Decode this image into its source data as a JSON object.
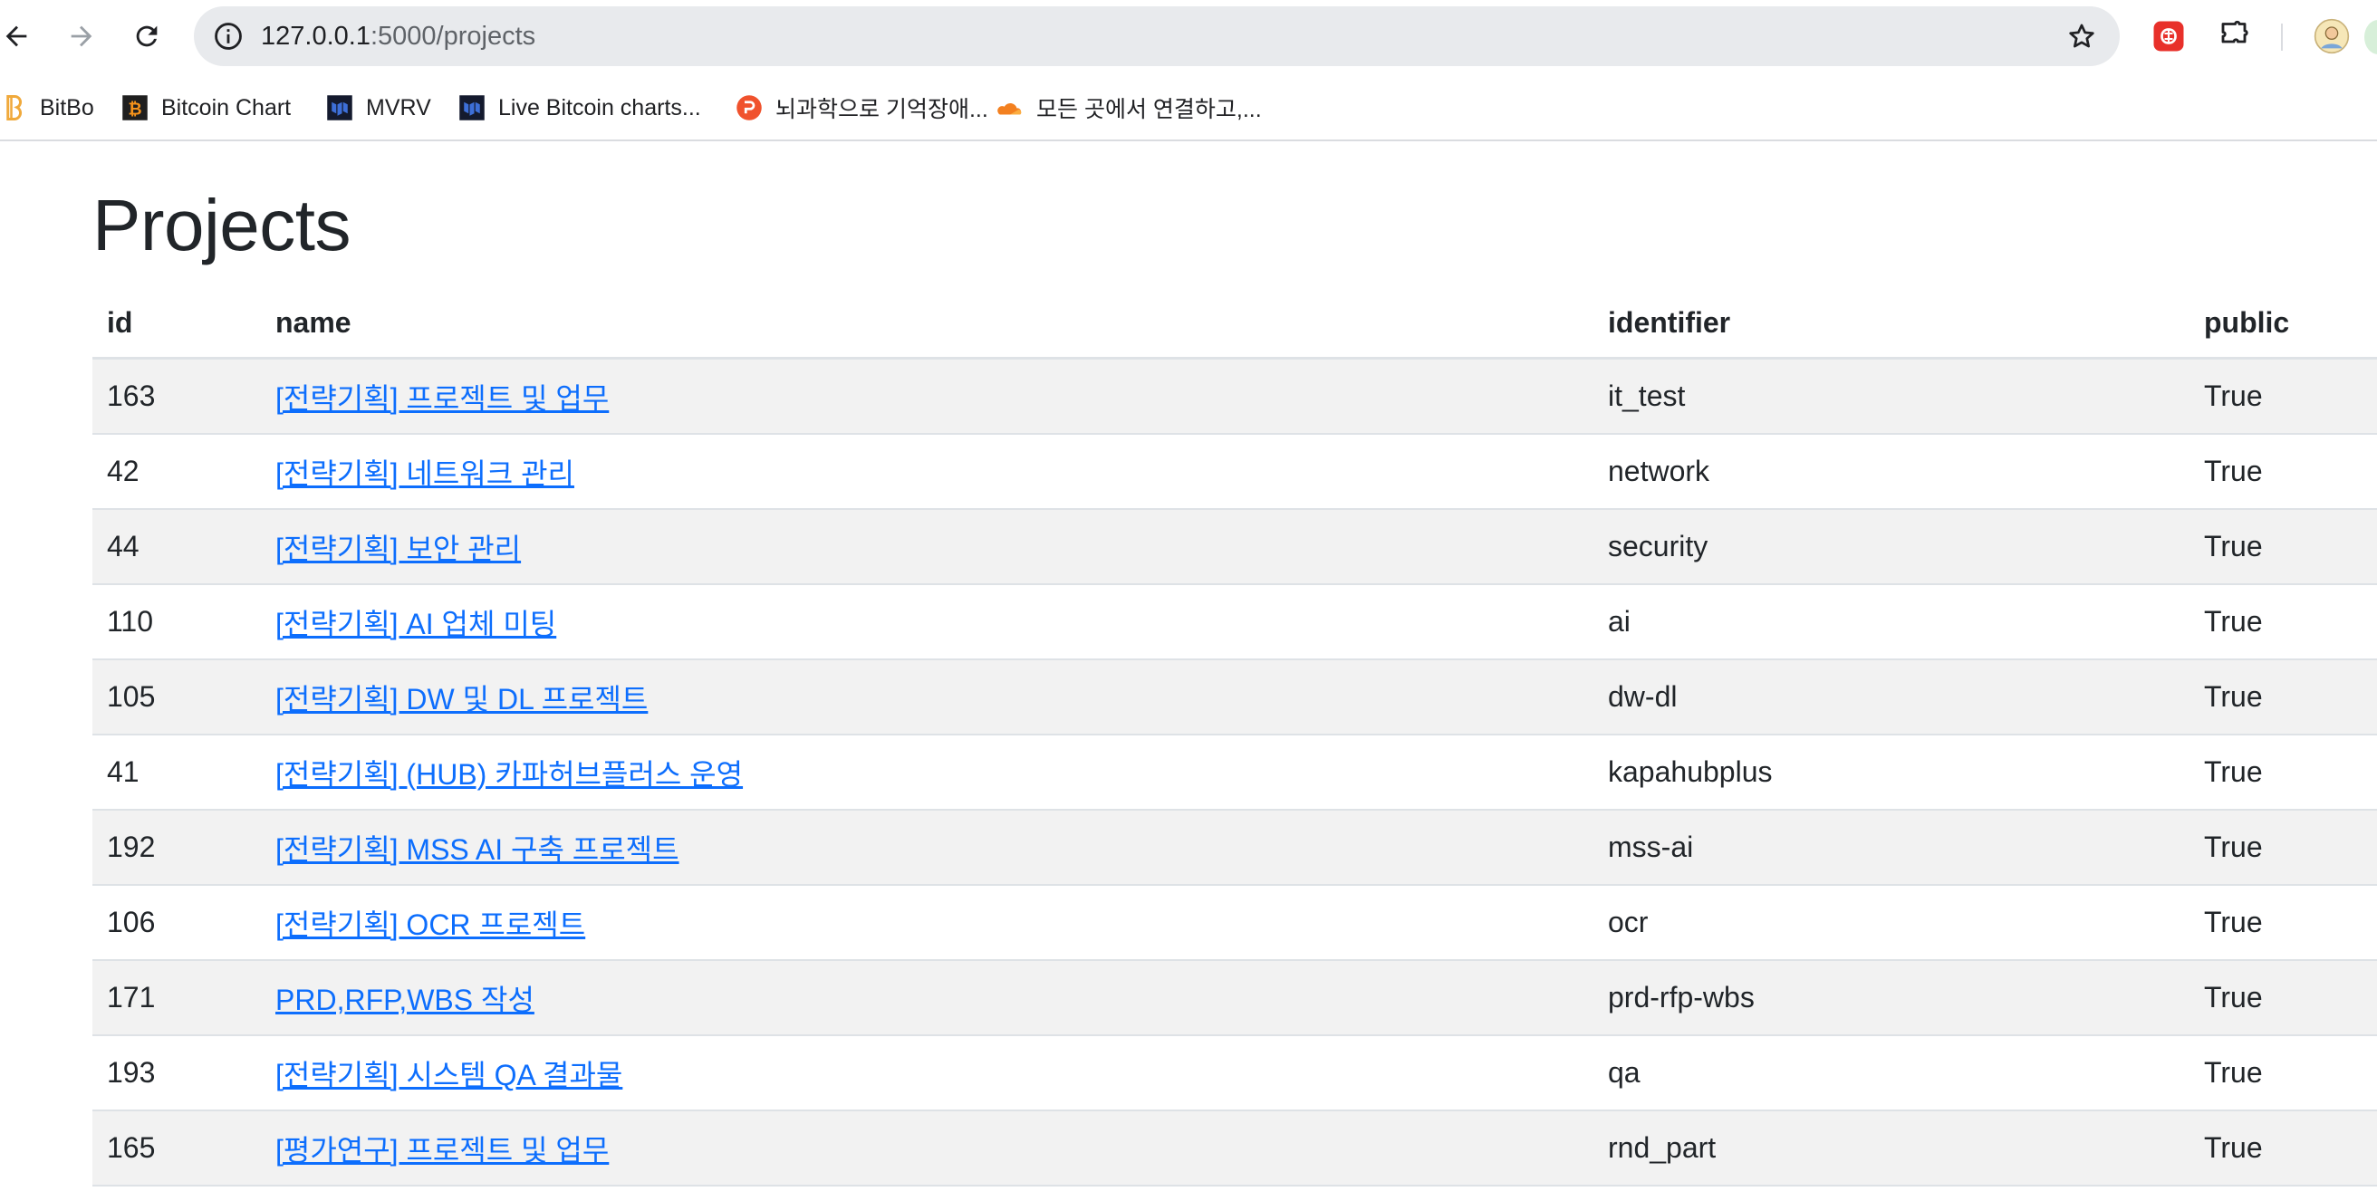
{
  "browser": {
    "url_host": "127.0.0.1",
    "url_rest": ":5000/projects",
    "bookmarks": [
      {
        "label": "BitBo",
        "icon": "bitbo-icon"
      },
      {
        "label": "Bitcoin Chart",
        "icon": "bitcoin-chart-icon"
      },
      {
        "label": "MVRV",
        "icon": "mvrv-icon"
      },
      {
        "label": "Live Bitcoin charts...",
        "icon": "live-bitcoin-icon"
      },
      {
        "label": "뇌과학으로 기억장애...",
        "icon": "brain-site-icon"
      },
      {
        "label": "모든 곳에서 연결하고,...",
        "icon": "cloudflare-icon"
      }
    ]
  },
  "page": {
    "title": "Projects",
    "columns": [
      "id",
      "name",
      "identifier",
      "public"
    ],
    "rows": [
      {
        "id": "163",
        "name": "[전략기획] 프로젝트 및 업무",
        "identifier": "it_test",
        "public": "True"
      },
      {
        "id": "42",
        "name": "[전략기획] 네트워크 관리",
        "identifier": "network",
        "public": "True"
      },
      {
        "id": "44",
        "name": "[전략기획] 보안 관리",
        "identifier": "security",
        "public": "True"
      },
      {
        "id": "110",
        "name": "[전략기획] AI 업체 미팅",
        "identifier": "ai",
        "public": "True"
      },
      {
        "id": "105",
        "name": "[전략기획] DW 및 DL 프로젝트",
        "identifier": "dw-dl",
        "public": "True"
      },
      {
        "id": "41",
        "name": "[전략기획] (HUB) 카파허브플러스 운영",
        "identifier": "kapahubplus",
        "public": "True"
      },
      {
        "id": "192",
        "name": "[전략기획] MSS AI 구축 프로젝트",
        "identifier": "mss-ai",
        "public": "True"
      },
      {
        "id": "106",
        "name": "[전략기획] OCR 프로젝트",
        "identifier": "ocr",
        "public": "True"
      },
      {
        "id": "171",
        "name": "PRD,RFP,WBS 작성",
        "identifier": "prd-rfp-wbs",
        "public": "True"
      },
      {
        "id": "193",
        "name": "[전략기획] 시스템 QA 결과물",
        "identifier": "qa",
        "public": "True"
      },
      {
        "id": "165",
        "name": "[평가연구] 프로젝트 및 업무",
        "identifier": "rnd_part",
        "public": "True"
      }
    ]
  },
  "colors": {
    "link": "#0d6efd",
    "stripe": "#f2f2f2",
    "omnibox": "#e8eaed",
    "extension_red": "#e8302a"
  }
}
